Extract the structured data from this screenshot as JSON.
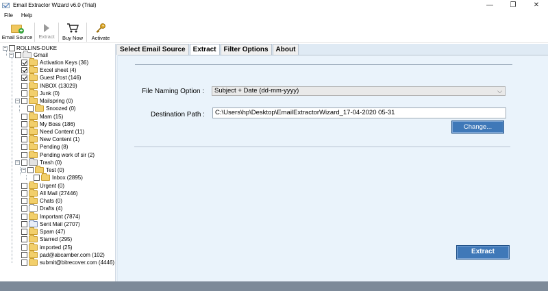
{
  "window": {
    "title": "Email Extractor Wizard v6.0 (Trial)",
    "minimize": "—",
    "maximize": "❐",
    "close": "✕"
  },
  "menu": {
    "file": "File",
    "help": "Help"
  },
  "toolbar": {
    "email_source": "Email Source",
    "extract": "Extract",
    "buy_now": "Buy Now",
    "activate": "Activate"
  },
  "tree": {
    "root": "ROLLINS-DUKE",
    "account": "Gmail",
    "items": [
      "Activation Keys (36)",
      "Excel sheet (4)",
      "Guest Post (146)",
      "INBOX (13029)",
      "Junk (0)",
      "Mailspring (0)",
      "Snoozed (0)",
      "Mam (15)",
      "My Boss (186)",
      "Need Content (11)",
      "New Content (1)",
      "Pending (8)",
      "Pending work of sir (2)",
      "Trash (0)",
      "Test (0)",
      "Inbox (2895)",
      "Urgent (0)",
      "All Mail (27446)",
      "Chats (0)",
      "Drafts (4)",
      "Important (7874)",
      "Sent Mail (2707)",
      "Spam (47)",
      "Starred (295)",
      "imported (25)",
      "pad@abcamber.com (102)",
      "submit@bitrecover.com (4446)"
    ],
    "expanders": {
      "collapse": "−"
    }
  },
  "tabs": [
    "Select Email Source",
    "Extract",
    "Filter Options",
    "About"
  ],
  "extract_tab": {
    "file_naming_label": "File Naming Option :",
    "file_naming_value": "Subject + Date (dd-mm-yyyy)",
    "dropdown_chevron": "⌵",
    "destination_label": "Destination Path :",
    "destination_value": "C:\\Users\\hp\\Desktop\\EmailExtractorWizard_17-04-2020 05-31",
    "change_button": "Change...",
    "extract_button": "Extract"
  },
  "colors": {
    "accent_button": "#3f78b8",
    "panel_background": "#eaf3fb",
    "status_bar": "#7d8a99"
  }
}
